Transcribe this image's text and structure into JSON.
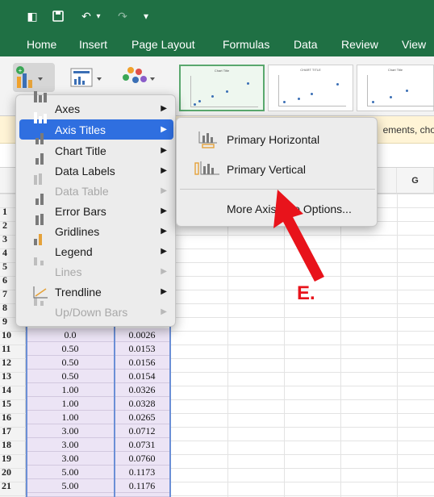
{
  "quick_access": [
    "◧",
    "💾",
    "↶",
    "▾",
    "↷",
    "▾"
  ],
  "ribbon_tabs": [
    "Home",
    "Insert",
    "Page Layout",
    "Formulas",
    "Data",
    "Review",
    "View"
  ],
  "chart_thumbs": [
    {
      "title": "Chart Title"
    },
    {
      "title": "CHART TITLE"
    },
    {
      "title": "Chart Title"
    }
  ],
  "infobar": {
    "text": "ements, cho"
  },
  "column_headers": {
    "g": "G"
  },
  "menu": {
    "items": [
      {
        "label": "Axes",
        "state": "normal",
        "icon": "axes-icon"
      },
      {
        "label": "Axis Titles",
        "state": "highlighted",
        "icon": "axis-titles-icon"
      },
      {
        "label": "Chart Title",
        "state": "normal",
        "icon": "chart-title-icon"
      },
      {
        "label": "Data Labels",
        "state": "normal",
        "icon": "data-labels-icon"
      },
      {
        "label": "Data Table",
        "state": "disabled",
        "icon": "data-table-icon"
      },
      {
        "label": "Error Bars",
        "state": "normal",
        "icon": "error-bars-icon"
      },
      {
        "label": "Gridlines",
        "state": "normal",
        "icon": "gridlines-icon"
      },
      {
        "label": "Legend",
        "state": "normal",
        "icon": "legend-icon"
      },
      {
        "label": "Lines",
        "state": "disabled",
        "icon": "lines-icon"
      },
      {
        "label": "Trendline",
        "state": "normal",
        "icon": "trendline-icon"
      },
      {
        "label": "Up/Down Bars",
        "state": "disabled",
        "icon": "up-down-bars-icon"
      }
    ]
  },
  "submenu": {
    "primary_horizontal": "Primary Horizontal",
    "primary_vertical": "Primary Vertical",
    "more_options": "More Axis Title Options..."
  },
  "annotation": {
    "label": "E."
  },
  "rows": [
    {
      "n": "10",
      "a": "0.0",
      "b": "0.0026"
    },
    {
      "n": "11",
      "a": "0.50",
      "b": "0.0153"
    },
    {
      "n": "12",
      "a": "0.50",
      "b": "0.0156"
    },
    {
      "n": "13",
      "a": "0.50",
      "b": "0.0154"
    },
    {
      "n": "14",
      "a": "1.00",
      "b": "0.0326"
    },
    {
      "n": "15",
      "a": "1.00",
      "b": "0.0328"
    },
    {
      "n": "16",
      "a": "1.00",
      "b": "0.0265"
    },
    {
      "n": "17",
      "a": "3.00",
      "b": "0.0712"
    },
    {
      "n": "18",
      "a": "3.00",
      "b": "0.0731"
    },
    {
      "n": "19",
      "a": "3.00",
      "b": "0.0760"
    },
    {
      "n": "20",
      "a": "5.00",
      "b": "0.1173"
    },
    {
      "n": "21",
      "a": "5.00",
      "b": "0.1176"
    }
  ],
  "hidden_row_numbers": [
    "1",
    "2",
    "3",
    "4",
    "5",
    "6",
    "7",
    "8",
    "9"
  ],
  "colors": {
    "ribbon": "#1f7044",
    "highlight": "#2f6fe0",
    "annotation": "#e8131b",
    "selection": "#ece4f5"
  }
}
